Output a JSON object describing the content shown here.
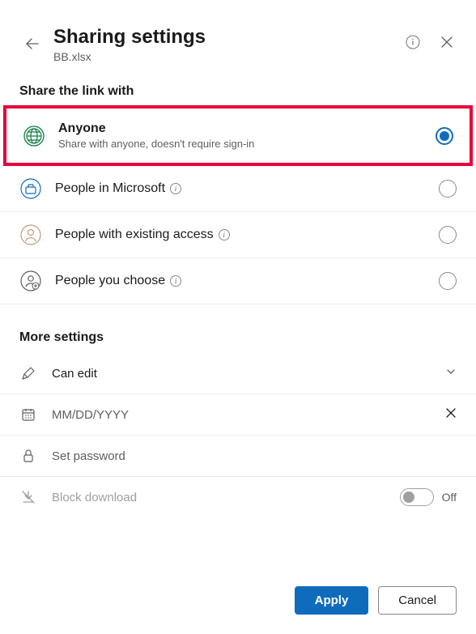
{
  "header": {
    "title": "Sharing settings",
    "filename": "BB.xlsx"
  },
  "share_section": {
    "label": "Share the link with",
    "options": [
      {
        "title": "Anyone",
        "desc": "Share with anyone, doesn't require sign-in",
        "selected": true
      },
      {
        "title": "People in Microsoft",
        "selected": false
      },
      {
        "title": "People with existing access",
        "selected": false
      },
      {
        "title": "People you choose",
        "selected": false
      }
    ]
  },
  "more_settings": {
    "label": "More settings",
    "edit": {
      "label": "Can edit"
    },
    "date": {
      "placeholder": "MM/DD/YYYY"
    },
    "password": {
      "placeholder": "Set password"
    },
    "block_download": {
      "label": "Block download",
      "toggle_state": "Off"
    }
  },
  "footer": {
    "apply": "Apply",
    "cancel": "Cancel"
  }
}
